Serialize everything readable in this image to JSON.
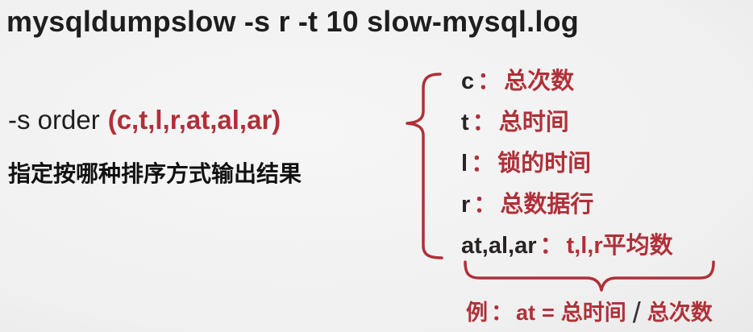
{
  "title": "mysqldumpslow -s r -t 10 slow-mysql.log",
  "option": {
    "flag": "-s order",
    "values": "(c,t,l,r,at,al,ar)",
    "description": "指定按哪种排序方式输出结果"
  },
  "orders": [
    {
      "key": "c",
      "sep": "：",
      "meaning": "总次数"
    },
    {
      "key": "t",
      "sep": "：",
      "meaning": "总时间"
    },
    {
      "key": "l",
      "sep": "：",
      "meaning": "锁的时间"
    },
    {
      "key": "r",
      "sep": "：",
      "meaning": "总数据行"
    },
    {
      "key": "at,al,ar",
      "sep": "：",
      "meaning": "t,l,r平均数"
    }
  ],
  "example": {
    "label": "例",
    "sep": "：",
    "term": "at",
    "eq": "=",
    "numerator": "总时间",
    "slash": "/",
    "denominator": "总次数"
  },
  "colors": {
    "accent": "#b03038",
    "text": "#222222",
    "background": "#f0f0f0"
  }
}
